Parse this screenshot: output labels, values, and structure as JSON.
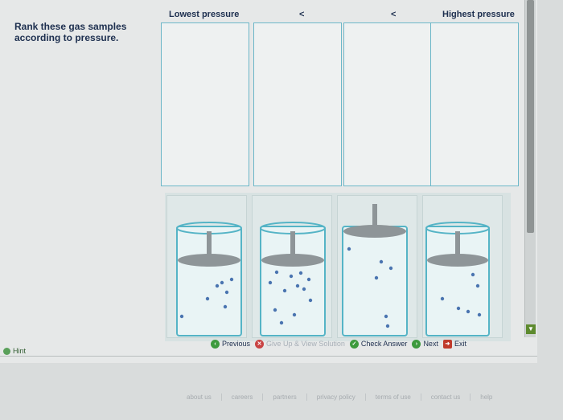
{
  "instructions": "Rank these gas samples according to pressure.",
  "ranking": {
    "lowest_label": "Lowest pressure",
    "separator_1": "<",
    "separator_2": "<",
    "highest_label": "Highest pressure"
  },
  "nav": {
    "previous": "Previous",
    "give_up": "Give Up & View Solution",
    "check": "Check Answer",
    "next": "Next",
    "exit": "Exit"
  },
  "hint": "Hint",
  "footer": [
    "about us",
    "careers",
    "partners",
    "privacy policy",
    "terms of use",
    "contact us",
    "help"
  ],
  "colors": {
    "target_border": "#6cb7c8",
    "heading_text": "#1d2f4f",
    "molecule": "#4a74b0"
  }
}
